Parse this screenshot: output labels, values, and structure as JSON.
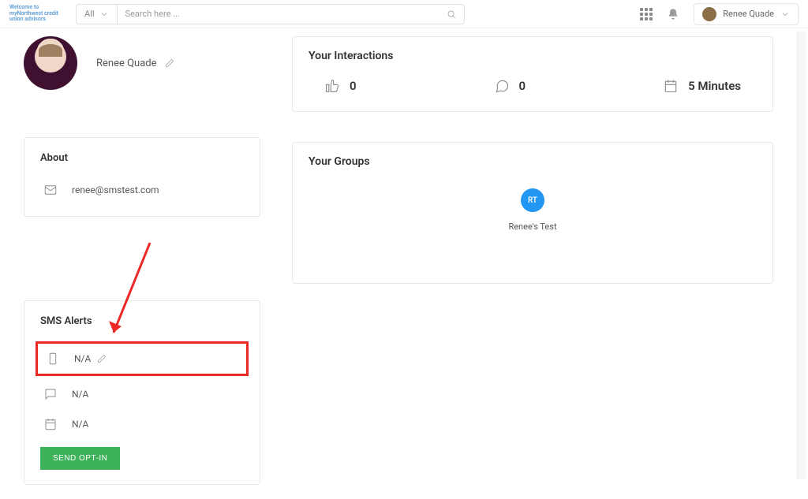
{
  "header": {
    "logo_text": "Welcome to myNorthwest credit union advisors",
    "all_label": "All",
    "search_placeholder": "Search here ...",
    "user_name": "Renee Quade"
  },
  "profile": {
    "name": "Renee Quade"
  },
  "about": {
    "title": "About",
    "email": "renee@smstest.com"
  },
  "sms": {
    "title": "SMS Alerts",
    "phone_value": "N/A",
    "message_value": "N/A",
    "date_value": "N/A",
    "send_label": "SEND OPT-IN"
  },
  "interactions": {
    "title": "Your Interactions",
    "likes": "0",
    "comments": "0",
    "time": "5 Minutes"
  },
  "groups": {
    "title": "Your Groups",
    "items": [
      {
        "initials": "RT",
        "name": "Renee's Test"
      }
    ]
  }
}
